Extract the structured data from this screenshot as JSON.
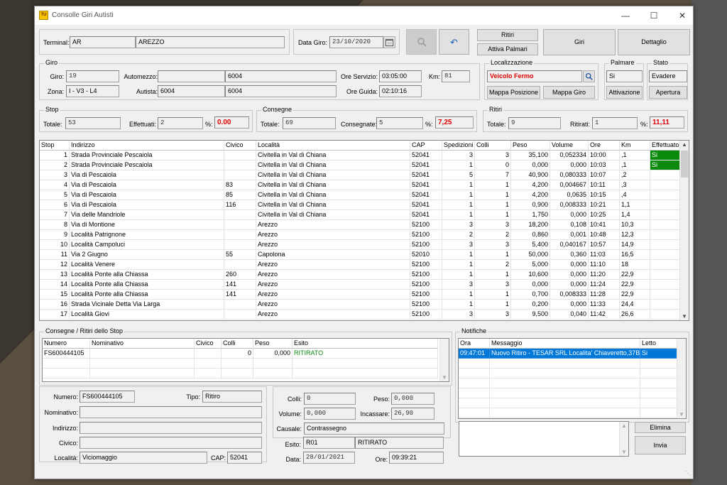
{
  "window": {
    "title": "Consolle Giri Autisti",
    "icon_label": "TU"
  },
  "terminal": {
    "label": "Terminal:",
    "code": "AR",
    "name": "AREZZO"
  },
  "data_giro": {
    "label": "Data Giro:",
    "value": "23/10/2020"
  },
  "toolbar": {
    "ritiri": "Ritiri",
    "attiva_palmari": "Attiva Palmari",
    "giri": "Giri",
    "dettaglio": "Dettaglio"
  },
  "giro": {
    "title": "Giro",
    "giro_label": "Giro:",
    "giro_value": "19",
    "zona_label": "Zona:",
    "zona_value": "I - V3 - L4",
    "automezzo_label": "Automezzo:",
    "automezzo_code": "",
    "automezzo_value": "6004",
    "autista_label": "Autista:",
    "autista_code": "6004",
    "autista_value": "6004",
    "ore_servizio_label": "Ore Servizio:",
    "ore_servizio": "03:05:00",
    "km_label": "Km:",
    "km": "81",
    "ore_guida_label": "Ore Guida:",
    "ore_guida": "02:10:16"
  },
  "localizzazione": {
    "title": "Localizzazione",
    "status": "Veicolo Fermo",
    "mappa_posizione": "Mappa Posizione",
    "mappa_giro": "Mappa Giro"
  },
  "palmare": {
    "title": "Palmare",
    "value": "Si",
    "button": "Attivazione"
  },
  "stato": {
    "title": "Stato",
    "value": "Evadere",
    "button": "Apertura"
  },
  "stop": {
    "title": "Stop",
    "totale_label": "Totale:",
    "totale": "53",
    "effettuati_label": "Effettuati:",
    "effettuati": "2",
    "pct_label": "%:",
    "pct": "0.00"
  },
  "consegne": {
    "title": "Consegne",
    "totale_label": "Totale:",
    "totale": "69",
    "consegnate_label": "Consegnate:",
    "consegnate": "5",
    "pct_label": "%:",
    "pct": "7,25"
  },
  "ritiri": {
    "title": "Ritiri",
    "totale_label": "Totale:",
    "totale": "9",
    "ritirati_label": "Ritirati:",
    "ritirati": "1",
    "pct_label": "%:",
    "pct": "11,11"
  },
  "stops_table": {
    "headers": [
      "Stop",
      "Indirizzo",
      "Civico",
      "Località",
      "CAP",
      "Spedizioni",
      "Colli",
      "Peso",
      "Volume",
      "Ore",
      "Km",
      "Effettuato"
    ],
    "rows": [
      [
        "1",
        "Strada Provinciale Pescaiola",
        "",
        "Civitella in Val di Chiana",
        "52041",
        "3",
        "3",
        "35,100",
        "0,052334",
        "10:00",
        ",1",
        "Si"
      ],
      [
        "2",
        "Strada Provinciale Pescaiola",
        "",
        "Civitella in Val di Chiana",
        "52041",
        "1",
        "0",
        "0,000",
        "0,000",
        "10:03",
        ",1",
        "Si"
      ],
      [
        "3",
        "Via di Pescaiola",
        "",
        "Civitella in Val di Chiana",
        "52041",
        "5",
        "7",
        "40,900",
        "0,080333",
        "10:07",
        ",2",
        ""
      ],
      [
        "4",
        "Via di Pescaiola",
        "83",
        "Civitella in Val di Chiana",
        "52041",
        "1",
        "1",
        "4,200",
        "0,004667",
        "10:11",
        ",3",
        ""
      ],
      [
        "5",
        "Via di Pescaiola",
        "85",
        "Civitella in Val di Chiana",
        "52041",
        "1",
        "1",
        "4,200",
        "0,0635",
        "10:15",
        ",4",
        ""
      ],
      [
        "6",
        "Via di Pescaiola",
        "116",
        "Civitella in Val di Chiana",
        "52041",
        "1",
        "1",
        "0,900",
        "0,008333",
        "10:21",
        "1,1",
        ""
      ],
      [
        "7",
        "Via delle Mandriole",
        "",
        "Civitella in Val di Chiana",
        "52041",
        "1",
        "1",
        "1,750",
        "0,000",
        "10:25",
        "1,4",
        ""
      ],
      [
        "8",
        "Via di Montione",
        "",
        "Arezzo",
        "52100",
        "3",
        "3",
        "18,200",
        "0,108",
        "10:41",
        "10,3",
        ""
      ],
      [
        "9",
        "Località Patrignone",
        "",
        "Arezzo",
        "52100",
        "2",
        "2",
        "0,860",
        "0,001",
        "10:48",
        "12,3",
        ""
      ],
      [
        "10",
        "Località Campoluci",
        "",
        "Arezzo",
        "52100",
        "3",
        "3",
        "5,400",
        "0,040167",
        "10:57",
        "14,9",
        ""
      ],
      [
        "11",
        "Via 2 Giugno",
        "55",
        "Capolona",
        "52010",
        "1",
        "1",
        "50,000",
        "0,360",
        "11:03",
        "16,5",
        ""
      ],
      [
        "12",
        "Località Venere",
        "",
        "Arezzo",
        "52100",
        "1",
        "2",
        "5,000",
        "0,000",
        "11:10",
        "18",
        ""
      ],
      [
        "13",
        "Località Ponte alla Chiassa",
        "260",
        "Arezzo",
        "52100",
        "1",
        "1",
        "10,600",
        "0,000",
        "11:20",
        "22,9",
        ""
      ],
      [
        "14",
        "Località Ponte alla Chiassa",
        "141",
        "Arezzo",
        "52100",
        "3",
        "3",
        "0,000",
        "0,000",
        "11:24",
        "22,9",
        ""
      ],
      [
        "15",
        "Località Ponte alla Chiassa",
        "141",
        "Arezzo",
        "52100",
        "1",
        "1",
        "0,700",
        "0,008333",
        "11:28",
        "22,9",
        ""
      ],
      [
        "16",
        "Strada Vicinale Detta Via Larga",
        "",
        "Arezzo",
        "52100",
        "1",
        "1",
        "0,200",
        "0,000",
        "11:33",
        "24,4",
        ""
      ],
      [
        "17",
        "Località Giovi",
        "",
        "Arezzo",
        "52100",
        "3",
        "3",
        "9,500",
        "0,040",
        "11:42",
        "26,6",
        ""
      ]
    ]
  },
  "consegne_ritiri": {
    "title": "Consegne / Ritiri dello Stop",
    "headers": [
      "Numero",
      "Nominativo",
      "Civico",
      "Colli",
      "Peso",
      "Esito"
    ],
    "rows": [
      [
        "FS600444105",
        "",
        "",
        "0",
        "0,000",
        "RITIRATO"
      ]
    ]
  },
  "notifiche": {
    "title": "Notifiche",
    "headers": [
      "Ora",
      "Messaggio",
      "Letto"
    ],
    "rows": [
      [
        "09:47:01",
        "Nuovo Ritiro - TESAR SRL Localita' Chiaveretto,37B S",
        "Si"
      ]
    ],
    "elimina": "Elimina",
    "invia": "Invia",
    "message_text": ""
  },
  "detail": {
    "numero_label": "Numero:",
    "numero": "FS600444105",
    "tipo_label": "Tipo:",
    "tipo": "Ritiro",
    "nominativo_label": "Nominativo:",
    "nominativo": "",
    "indirizzo_label": "Indirizzo:",
    "indirizzo": "",
    "civico_label": "Civico:",
    "civico": "",
    "localita_label": "Località:",
    "localita": "Viciomaggio",
    "cap_label": "CAP:",
    "cap": "52041",
    "colli_label": "Colli:",
    "colli": "0",
    "peso_label": "Peso:",
    "peso": "0,000",
    "volume_label": "Volume:",
    "volume": "0,000",
    "incassare_label": "Incassare:",
    "incassare": "26,90",
    "causale_label": "Causale:",
    "causale": "Contrassegno",
    "esito_label": "Esito:",
    "esito_code": "R01",
    "esito": "RITIRATO",
    "data_label": "Data:",
    "data": "28/01/2021",
    "ore_label": "Ore:",
    "ore": "09:39:21"
  },
  "colors": {
    "accent": "#0078d7",
    "green": "#0a8a0a",
    "red": "#e00000"
  }
}
